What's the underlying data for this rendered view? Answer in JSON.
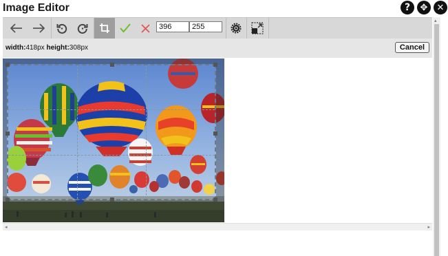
{
  "window": {
    "title": "Image Editor",
    "help_icon": "help-icon",
    "move_icon": "move-icon",
    "close_icon": "close-icon"
  },
  "toolbar": {
    "tools": [
      {
        "name": "undo",
        "icon": "arrow-left-icon"
      },
      {
        "name": "redo",
        "icon": "arrow-right-icon"
      },
      {
        "name": "rotate-left",
        "icon": "rotate-ccw-icon"
      },
      {
        "name": "rotate-right",
        "icon": "rotate-cw-icon"
      },
      {
        "name": "crop",
        "icon": "crop-icon",
        "active": true
      },
      {
        "name": "apply",
        "icon": "checkmark-icon",
        "color": "#6abf2e"
      },
      {
        "name": "discard",
        "icon": "x-icon",
        "color": "#e25656"
      },
      {
        "name": "adjust",
        "icon": "gear-icon"
      },
      {
        "name": "resize",
        "icon": "resize-icon"
      }
    ],
    "crop_width_value": "396",
    "crop_height_value": "255"
  },
  "info": {
    "width_label": "width:",
    "width_value": "418px",
    "height_label": "height:",
    "height_value": "308px",
    "cancel_label": "Cancel"
  },
  "scroll": {
    "left_arrow": "◂",
    "right_arrow": "▸",
    "up_arrow": "▴"
  },
  "colors": {
    "toolbar_bg": "#d8d8d8",
    "active_tool_bg": "#9e9e9e",
    "accept": "#6abf2e",
    "reject": "#e25656"
  }
}
